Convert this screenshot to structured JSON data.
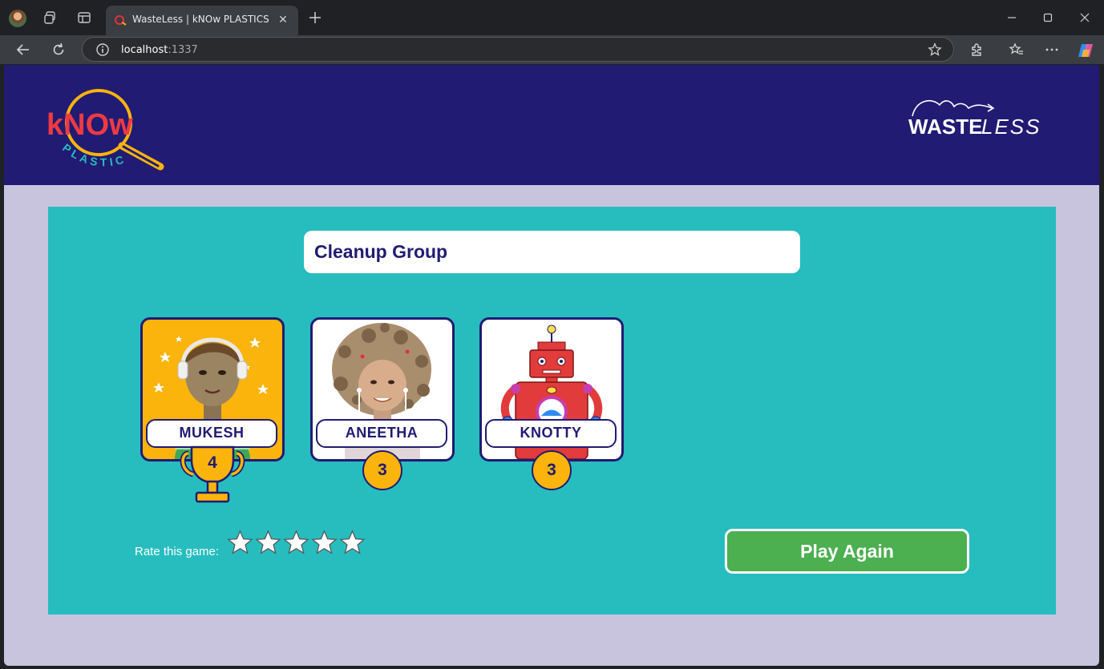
{
  "browser": {
    "tab_title": "WasteLess | kNOw PLASTICS",
    "url_host": "localhost",
    "url_port": ":1337"
  },
  "header": {
    "logo_left": {
      "line1": "kNOw",
      "line2": "PLASTICS"
    },
    "logo_right": {
      "bold": "WASTE",
      "light": "LESS"
    }
  },
  "game": {
    "group_name": "Cleanup Group",
    "players": [
      {
        "name": "MUKESH",
        "score": "4",
        "winner": true
      },
      {
        "name": "ANEETHA",
        "score": "3",
        "winner": false
      },
      {
        "name": "KNOTTY",
        "score": "3",
        "winner": false
      }
    ],
    "rating": {
      "label": "Rate this game:",
      "max_stars": 5,
      "value": 0
    },
    "play_again_label": "Play Again"
  },
  "colors": {
    "header_bg": "#211b73",
    "panel_bg": "#27bdbf",
    "page_bg": "#c8c4de",
    "accent_gold": "#fbb40b",
    "button_green": "#4caf50"
  }
}
